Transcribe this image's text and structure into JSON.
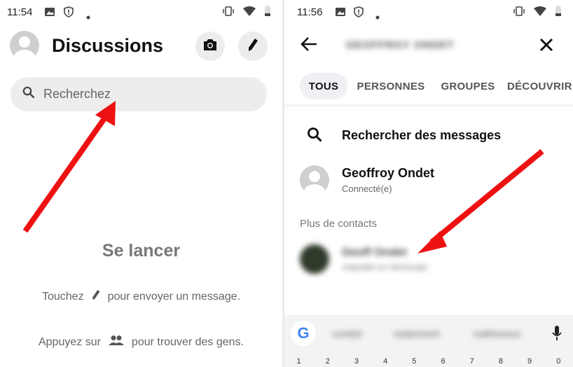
{
  "left": {
    "status": {
      "time": "11:54"
    },
    "header": {
      "title": "Discussions"
    },
    "search": {
      "placeholder": "Recherchez"
    },
    "empty": {
      "title": "Se lancer",
      "hint1_before": "Touchez",
      "hint1_after": "pour envoyer un message.",
      "hint2_before": "Appuyez sur",
      "hint2_after": "pour trouver des gens."
    }
  },
  "right": {
    "status": {
      "time": "11:56"
    },
    "header": {
      "query": "GEOFFROY ONDET"
    },
    "tabs": [
      {
        "label": "TOUS"
      },
      {
        "label": "PERSONNES"
      },
      {
        "label": "GROUPES"
      },
      {
        "label": "DÉCOUVRIR"
      }
    ],
    "search_messages": "Rechercher des messages",
    "contact": {
      "name": "Geoffroy Ondet",
      "status": "Connecté(e)"
    },
    "section": "Plus de contacts",
    "more_contact": {
      "name": "Geoff Ondet",
      "sub": "Joignable sur Messenger"
    },
    "keyboard": {
      "suggestions": [
        "conduit",
        "notamment",
        "malheureux"
      ],
      "numbers": [
        "1",
        "2",
        "3",
        "4",
        "5",
        "6",
        "7",
        "8",
        "9",
        "0"
      ]
    }
  },
  "colors": {
    "arrow": "#ee1111",
    "google_blue": "#4285F4"
  }
}
